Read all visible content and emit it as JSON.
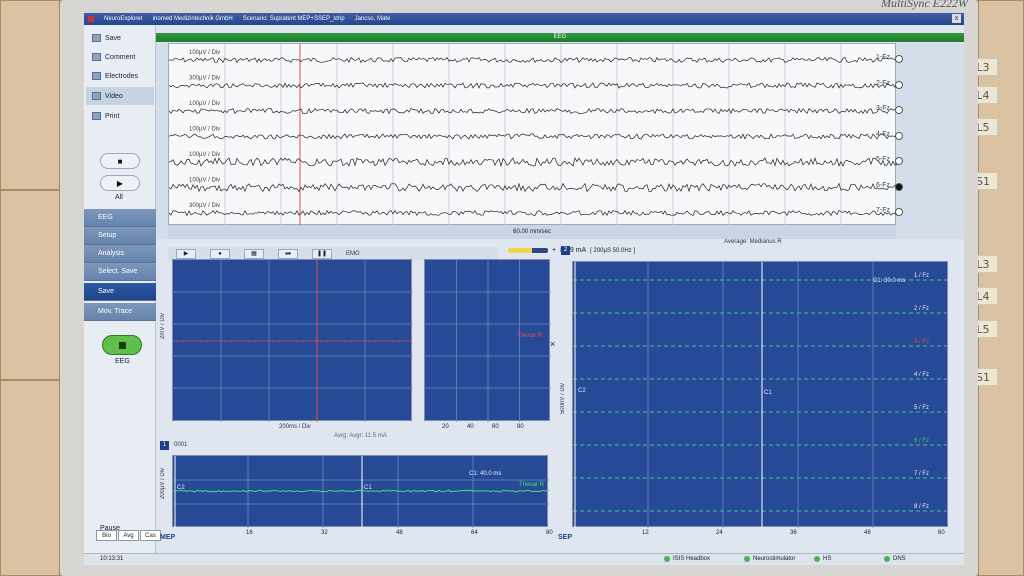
{
  "monitor": {
    "brand": "MultiSync E222W"
  },
  "wall": {
    "sticky_notes": [
      "L3",
      "L4",
      "L5",
      "S1",
      "L3",
      "L4",
      "L5",
      "S1"
    ]
  },
  "titlebar": {
    "app": "NeuroExplorer",
    "company": "inomed Medizintechnik GmbH",
    "scenario": "Scenario: Supratent MEP+SSEP_strip",
    "user": "Jancso, Mate",
    "close": "x"
  },
  "sidebar": {
    "top_buttons": [
      {
        "label": "Save",
        "icon": "save-icon"
      },
      {
        "label": "Comment",
        "icon": "comment-icon"
      },
      {
        "label": "Electrodes",
        "icon": "electrodes-icon"
      },
      {
        "label": "Video",
        "icon": "video-icon"
      },
      {
        "label": "Print",
        "icon": "print-icon"
      }
    ],
    "stop_symbol": "■",
    "play_symbol": "▶",
    "all_label": "All",
    "nav": [
      "EEG",
      "Setup",
      "Analysis",
      "Select. Save",
      "Save",
      "Mov. Trace"
    ],
    "eeg_button_label": "EEG",
    "pause_label": "Pause",
    "mode_tabs": [
      "Bio",
      "Avg",
      "Cas"
    ],
    "clock": "10:13:31"
  },
  "eeg": {
    "header": "EEG",
    "footer": "60.00 mm/sec",
    "channels": [
      {
        "scale": "100µV / Div",
        "label": "1-Fz",
        "selected": false
      },
      {
        "scale": "300µV / Div",
        "label": "2-Fz",
        "selected": false
      },
      {
        "scale": "100µV / Div",
        "label": "3-Fz",
        "selected": false
      },
      {
        "scale": "100µV / Div",
        "label": "4-Fz",
        "selected": false
      },
      {
        "scale": "100µV / Div",
        "label": "5-Fz",
        "selected": false
      },
      {
        "scale": "100µV / Div",
        "label": "6-Fz",
        "selected": true
      },
      {
        "scale": "300µV / Div",
        "label": "7-Fz",
        "selected": false
      }
    ]
  },
  "emg": {
    "header": "EMG",
    "y_scale": "2mV / Div",
    "x_scale": "200ms / Div",
    "stim_current": "8.89 mA",
    "stim_params": "[ 200µS  50.0Hz ]",
    "plus": "+",
    "trigger_label": "Thenar R",
    "close_symbol": "×",
    "right_ticks": [
      "20",
      "40",
      "60",
      "80"
    ]
  },
  "mep": {
    "tab_number": "1",
    "tab_name": "0001",
    "subheader": "Avrg: Avgr: 11.5 mA",
    "y_scale": "200µV / Div",
    "cursor_c1": "C1",
    "cursor_c2": "C2",
    "c1_readout": "C1:  40.0 ms",
    "trace_label": "Thenar R",
    "x_ticks": [
      "16",
      "32",
      "48",
      "64",
      "80"
    ],
    "label": "MEP"
  },
  "sep": {
    "tab_number": "2",
    "header": "Average: Medianus R",
    "y_scale": "500nV / Div",
    "cursor_c1": "C1",
    "cursor_c2": "C2",
    "c1_readout": "C1:  30.0 ms",
    "channels": [
      "1 / Fz",
      "2 / Fz",
      "3 / Fz",
      "4 / Fz",
      "5 / Fz",
      "6 / Fz",
      "7 / Fz",
      "8 / Fz"
    ],
    "x_ticks": [
      "12",
      "24",
      "36",
      "48",
      "60"
    ],
    "label": "SEP"
  },
  "status": {
    "items": [
      "ISIS Headbox",
      "Neurostimulator",
      "HS",
      "DNS"
    ]
  },
  "colors": {
    "plot_bg": "#274a96",
    "nav_active": "#1e4589",
    "eeg_green": "#2f9a3e",
    "cursor_red": "#e05050",
    "mep_trace": "#40e07a"
  }
}
